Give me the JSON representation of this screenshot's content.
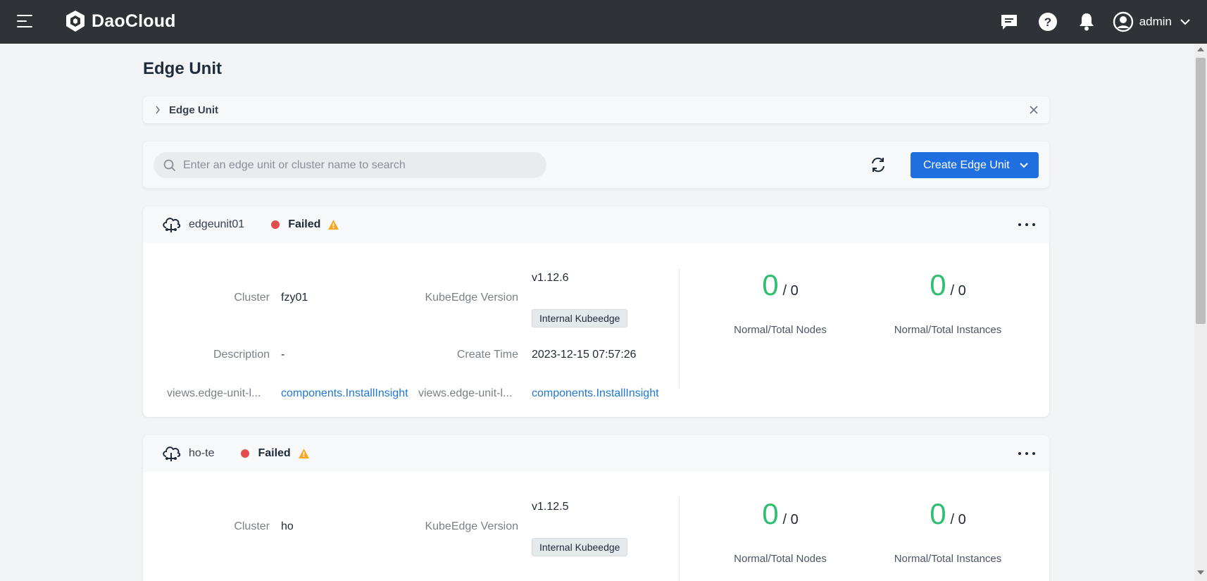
{
  "app": {
    "brand": "DaoCloud",
    "user": "admin"
  },
  "header": {
    "title": "Edge Unit"
  },
  "breadcrumb": {
    "label": "Edge Unit"
  },
  "toolbar": {
    "search_placeholder": "Enter an edge unit or cluster name to search",
    "create_label": "Create Edge Unit"
  },
  "labels": {
    "cluster": "Cluster",
    "kubeedge_version": "KubeEdge Version",
    "description": "Description",
    "create_time": "Create Time",
    "truncated_key": "views.edge-unit-l...",
    "normal_total_nodes": "Normal/Total Nodes",
    "normal_total_instances": "Normal/Total Instances"
  },
  "units": [
    {
      "name": "edgeunit01",
      "status": "Failed",
      "cluster": "fzy01",
      "version": "v1.12.6",
      "version_tag": "Internal Kubeedge",
      "description": "-",
      "create_time": "2023-12-15 07:57:26",
      "link1": "components.InstallInsight",
      "link2": "components.InstallInsight",
      "nodes_normal": "0",
      "nodes_total": "/ 0",
      "instances_normal": "0",
      "instances_total": "/ 0"
    },
    {
      "name": "ho-te",
      "status": "Failed",
      "cluster": "ho",
      "version": "v1.12.5",
      "version_tag": "Internal Kubeedge",
      "nodes_normal": "0",
      "nodes_total": "/ 0",
      "instances_normal": "0",
      "instances_total": "/ 0"
    }
  ],
  "colors": {
    "topbar": "#2f3337",
    "primary": "#1f6fe0",
    "success": "#2fbf71",
    "danger": "#e24c4c",
    "warning": "#f5a623",
    "link": "#1f78d1"
  }
}
